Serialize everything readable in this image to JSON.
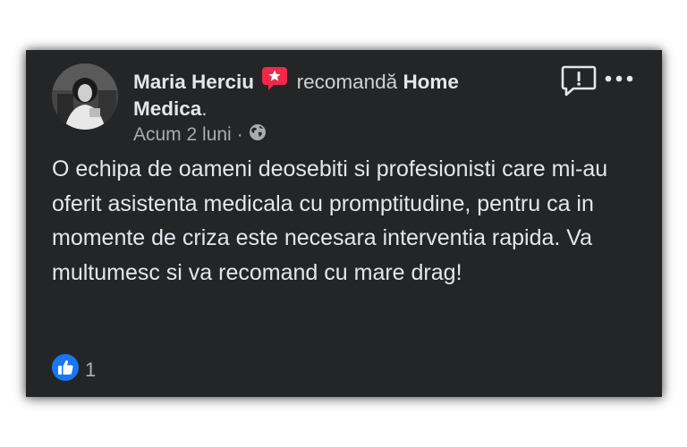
{
  "post": {
    "author": "Maria Herciu",
    "action": "recomandă",
    "page_name_line1": "Home",
    "page_name_line2": "Medica",
    "period": ".",
    "timestamp": "Acum 2 luni",
    "separator": "·",
    "audience_icon": "globe-icon",
    "badge_icon": "recommendation-star-icon",
    "text": "O echipa de oameni deosebiti si profesionisti care mi-au oferit asistenta medicala cu promptitudine, pentru ca in momente de criza este necesara interventia rapida. Va multumesc si va recomand cu mare drag!",
    "like_count": "1"
  },
  "icons": {
    "report": "report-exclamation-icon",
    "more": "more-dots-icon",
    "like": "like-thumb-icon"
  },
  "colors": {
    "card_bg": "#242526",
    "text": "#e4e6eb",
    "secondary": "#a8abaf",
    "badge": "#f0284a",
    "like_blue": "#1877f2"
  }
}
